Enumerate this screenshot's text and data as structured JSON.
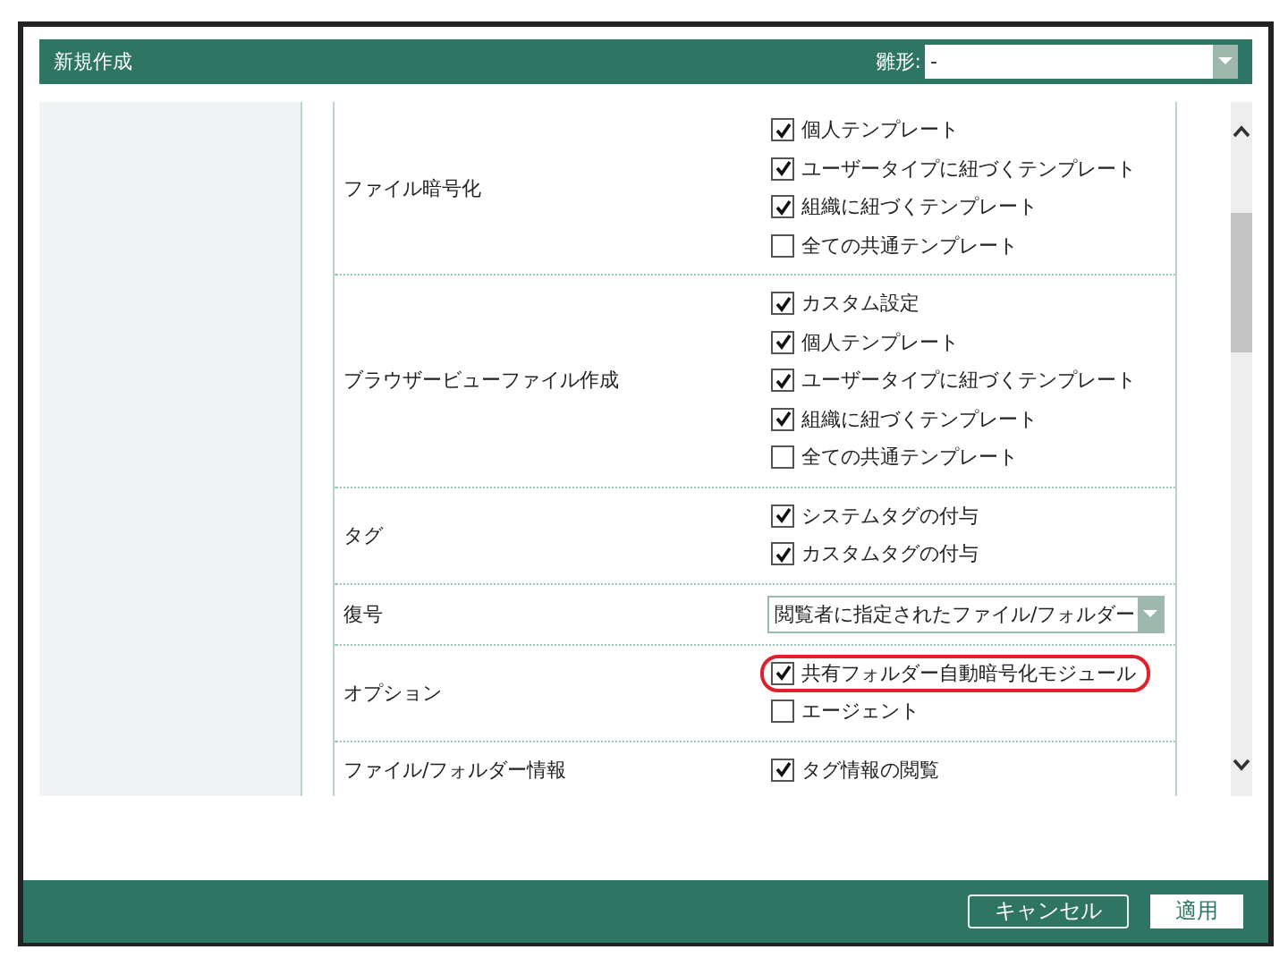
{
  "dialog": {
    "title": "新規作成",
    "template_label": "雛形:",
    "template_value": "-"
  },
  "rows": [
    {
      "label": "ファイル暗号化",
      "kind": "checks",
      "options": [
        {
          "label": "個人テンプレート",
          "checked": true,
          "highlighted": false
        },
        {
          "label": "ユーザータイプに紐づくテンプレート",
          "checked": true,
          "highlighted": false
        },
        {
          "label": "組織に紐づくテンプレート",
          "checked": true,
          "highlighted": false
        },
        {
          "label": "全ての共通テンプレート",
          "checked": false,
          "highlighted": false
        }
      ]
    },
    {
      "label": "ブラウザービューファイル作成",
      "kind": "checks",
      "options": [
        {
          "label": "カスタム設定",
          "checked": true,
          "highlighted": false
        },
        {
          "label": "個人テンプレート",
          "checked": true,
          "highlighted": false
        },
        {
          "label": "ユーザータイプに紐づくテンプレート",
          "checked": true,
          "highlighted": false
        },
        {
          "label": "組織に紐づくテンプレート",
          "checked": true,
          "highlighted": false
        },
        {
          "label": "全ての共通テンプレート",
          "checked": false,
          "highlighted": false
        }
      ]
    },
    {
      "label": "タグ",
      "kind": "checks",
      "options": [
        {
          "label": "システムタグの付与",
          "checked": true,
          "highlighted": false
        },
        {
          "label": "カスタムタグの付与",
          "checked": true,
          "highlighted": false
        }
      ]
    },
    {
      "label": "復号",
      "kind": "select",
      "value": "閲覧者に指定されたファイル/フォルダー"
    },
    {
      "label": "オプション",
      "kind": "checks",
      "options": [
        {
          "label": "共有フォルダー自動暗号化モジュール",
          "checked": true,
          "highlighted": true
        },
        {
          "label": "エージェント",
          "checked": false,
          "highlighted": false
        }
      ]
    },
    {
      "label": "ファイル/フォルダー情報",
      "kind": "checks",
      "options": [
        {
          "label": "タグ情報の閲覧",
          "checked": true,
          "highlighted": false
        }
      ]
    }
  ],
  "buttons": [
    {
      "label": "キャンセル",
      "kind": "secondary"
    },
    {
      "label": "適用",
      "kind": "primary"
    }
  ]
}
